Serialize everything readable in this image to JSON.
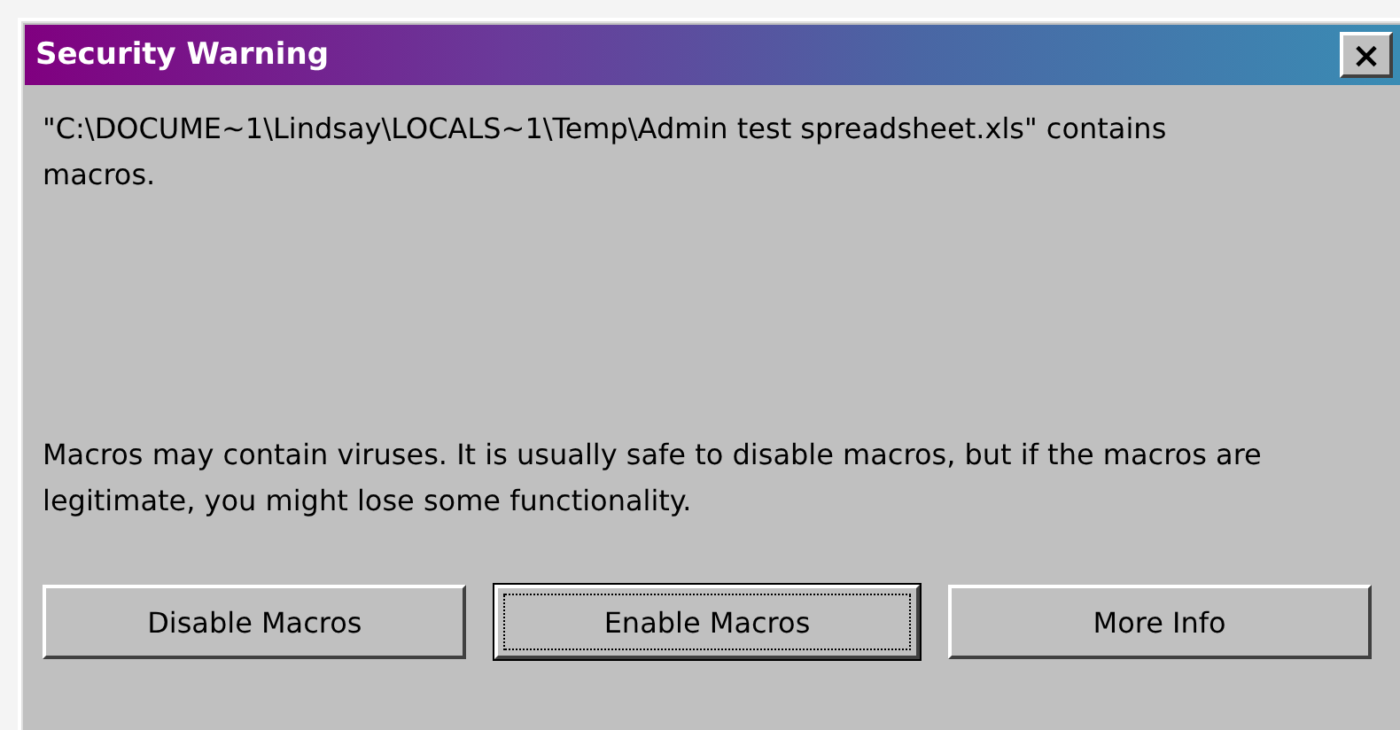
{
  "window": {
    "title": "Security Warning",
    "close": "×"
  },
  "message": "\"C:\\DOCUME~1\\Lindsay\\LOCALS~1\\Temp\\Admin test spreadsheet.xls\" contains macros.",
  "warning": "Macros may contain viruses. It is usually safe to disable macros, but if the macros are legitimate, you might lose some functionality.",
  "buttons": [
    {
      "label": "Disable Macros",
      "focused": false
    },
    {
      "label": "Enable Macros",
      "focused": true
    },
    {
      "label": "More Info",
      "focused": false
    }
  ]
}
